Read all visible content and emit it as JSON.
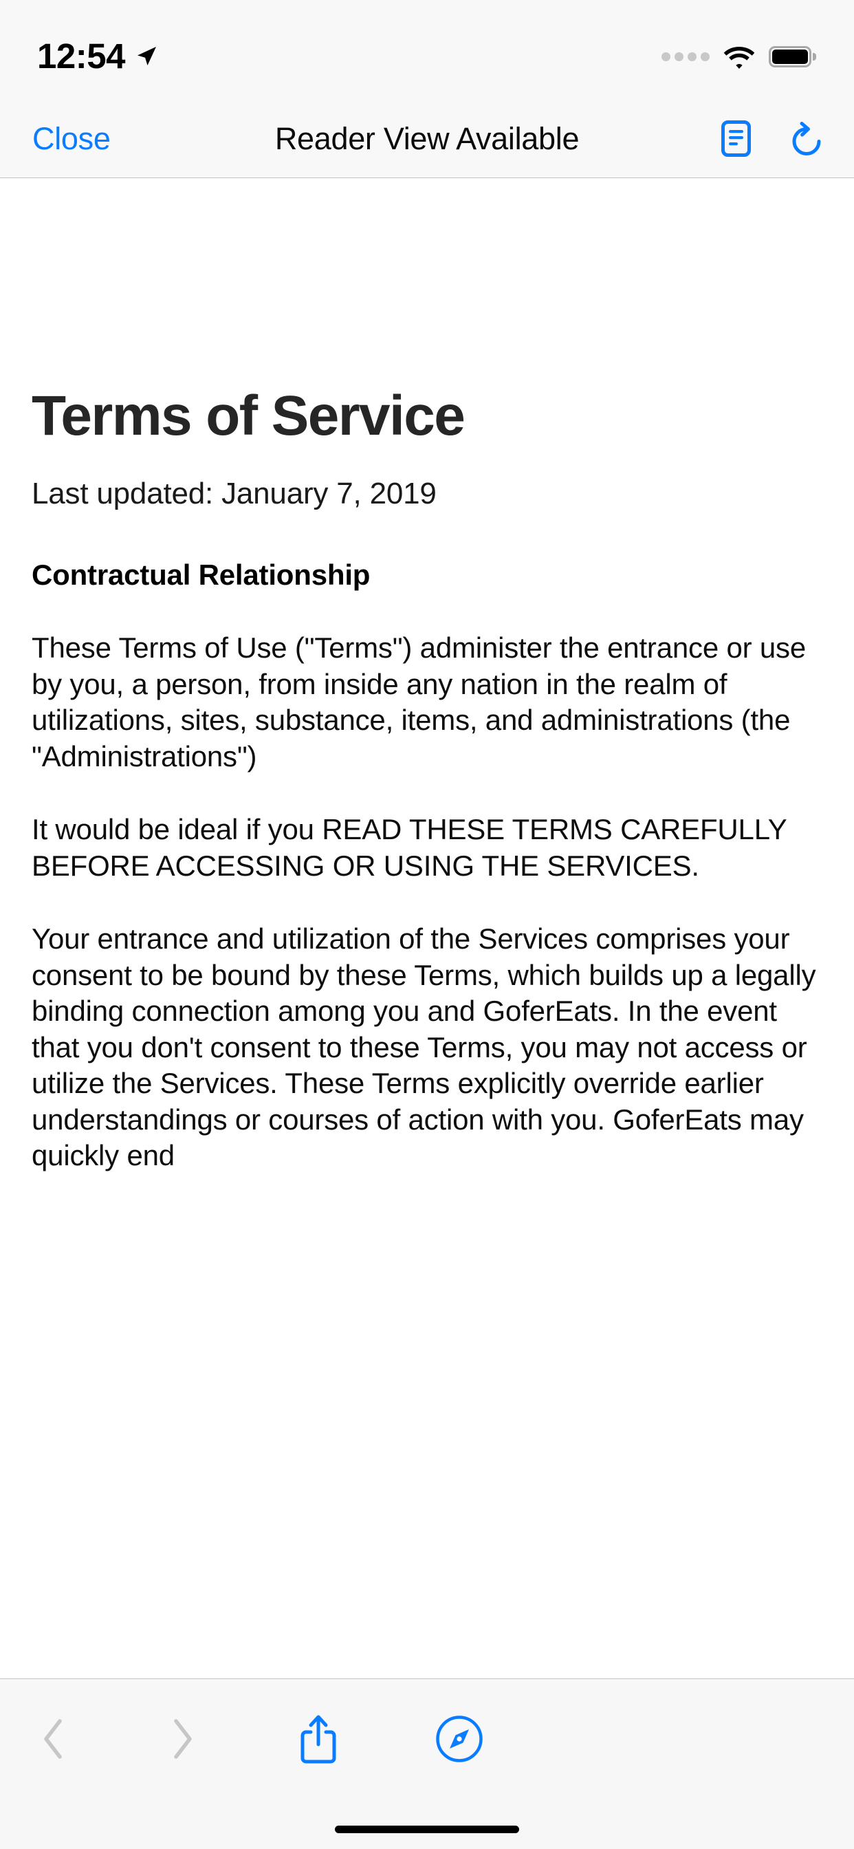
{
  "status_bar": {
    "time": "12:54",
    "location_icon": "location-arrow-icon",
    "signal_icon": "signal-dots-icon",
    "wifi_icon": "wifi-icon",
    "battery_icon": "battery-full-icon"
  },
  "nav_bar": {
    "close_label": "Close",
    "title": "Reader View Available",
    "reader_icon": "reader-view-icon",
    "reload_icon": "reload-icon",
    "accent_color": "#0a7cff"
  },
  "document": {
    "title": "Terms of Service",
    "last_updated": "Last updated: January 7, 2019",
    "section_heading": "Contractual Relationship",
    "paragraphs": [
      "These Terms of Use (\"Terms\") administer the entrance or use by you, a person, from inside any nation in the realm of utilizations, sites, substance, items, and administrations (the \"Administrations\")",
      "It would be ideal if you READ THESE TERMS CAREFULLY BEFORE ACCESSING OR USING THE SERVICES.",
      "Your entrance and utilization of the Services comprises your consent to be bound by these Terms, which builds up a legally binding connection among you and GoferEats. In the event that you don't consent to these Terms, you may not access or utilize the Services. These Terms explicitly override earlier understandings or courses of action with you. GoferEats may quickly end"
    ]
  },
  "toolbar": {
    "back_label": "Back",
    "forward_label": "Forward",
    "share_label": "Share",
    "safari_label": "Open in Safari",
    "back_icon": "chevron-left-icon",
    "forward_icon": "chevron-right-icon",
    "share_icon": "share-icon",
    "safari_icon": "safari-compass-icon",
    "back_enabled": false,
    "forward_enabled": false,
    "disabled_color": "#c6c6c8",
    "accent_color": "#0a7cff"
  }
}
